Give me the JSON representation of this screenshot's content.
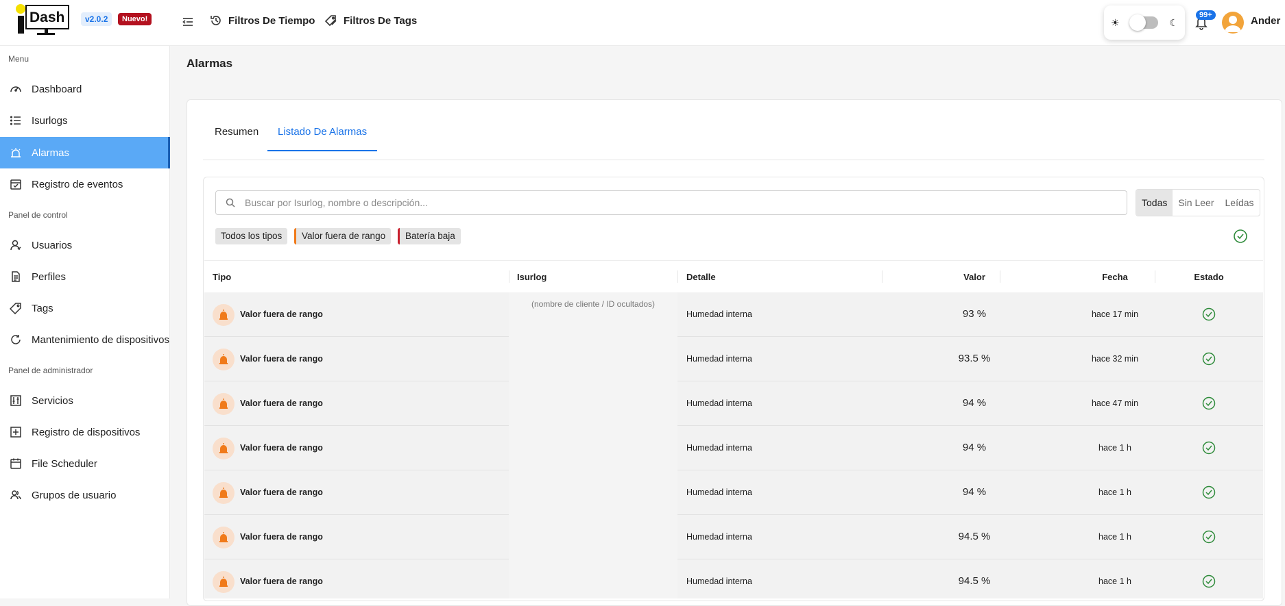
{
  "header": {
    "logo_text": "Dash",
    "version": "v2.0.2",
    "new_badge": "Nuevo!",
    "time_filters": "Filtros De Tiempo",
    "tag_filters": "Filtros De Tags",
    "notifications_count": "99+",
    "user_name": "Ander",
    "theme_toggle_dark": false
  },
  "sidebar": {
    "sections": [
      "Menu",
      "Panel de control",
      "Panel de administrador"
    ],
    "items": [
      {
        "label": "Dashboard",
        "icon": "gauge-icon"
      },
      {
        "label": "Isurlogs",
        "icon": "list-icon"
      },
      {
        "label": "Alarmas",
        "icon": "alarm-icon",
        "active": true
      },
      {
        "label": "Registro de eventos",
        "icon": "calendar-check-icon"
      },
      {
        "label": "Usuarios",
        "icon": "user-icon"
      },
      {
        "label": "Perfiles",
        "icon": "document-icon"
      },
      {
        "label": "Tags",
        "icon": "tag-icon"
      },
      {
        "label": "Mantenimiento de dispositivos",
        "icon": "refresh-icon"
      },
      {
        "label": "Servicios",
        "icon": "sliders-icon"
      },
      {
        "label": "Registro de dispositivos",
        "icon": "plus-square-icon"
      },
      {
        "label": "File Scheduler",
        "icon": "calendar-icon"
      },
      {
        "label": "Grupos de usuario",
        "icon": "user-group-icon"
      }
    ]
  },
  "main": {
    "title": "Alarmas",
    "tabs": [
      "Resumen",
      "Listado De Alarmas"
    ],
    "active_tab": 1,
    "search_placeholder": "Buscar por Isurlog, nombre o descripción...",
    "read_filter": [
      "Todas",
      "Sin Leer",
      "Leídas"
    ],
    "read_filter_selected": 0,
    "type_chips": [
      "Todos los tipos",
      "Valor fuera de rango",
      "Batería baja"
    ],
    "columns": [
      "Tipo",
      "Isurlog",
      "Detalle",
      "Valor",
      "Fecha",
      "Estado"
    ],
    "isurlog_hidden_note": "(nombre de cliente / ID ocultados)",
    "rows": [
      {
        "type": "Valor fuera de rango",
        "detail": "Humedad interna",
        "value": "93 %",
        "date": "hace 17 min"
      },
      {
        "type": "Valor fuera de rango",
        "detail": "Humedad interna",
        "value": "93.5 %",
        "date": "hace 32 min"
      },
      {
        "type": "Valor fuera de rango",
        "detail": "Humedad interna",
        "value": "94 %",
        "date": "hace 47 min"
      },
      {
        "type": "Valor fuera de rango",
        "detail": "Humedad interna",
        "value": "94 %",
        "date": "hace 1 h"
      },
      {
        "type": "Valor fuera de rango",
        "detail": "Humedad interna",
        "value": "94 %",
        "date": "hace 1 h"
      },
      {
        "type": "Valor fuera de rango",
        "detail": "Humedad interna",
        "value": "94.5 %",
        "date": "hace 1 h"
      },
      {
        "type": "Valor fuera de rango",
        "detail": "Humedad interna",
        "value": "94.5 %",
        "date": "hace 1 h"
      }
    ]
  },
  "colors": {
    "accent": "#1a73e8",
    "sidebar_active": "#5aa9f6",
    "warning": "#f07a1a",
    "danger": "#c8202e",
    "success": "#2e8b3a"
  }
}
